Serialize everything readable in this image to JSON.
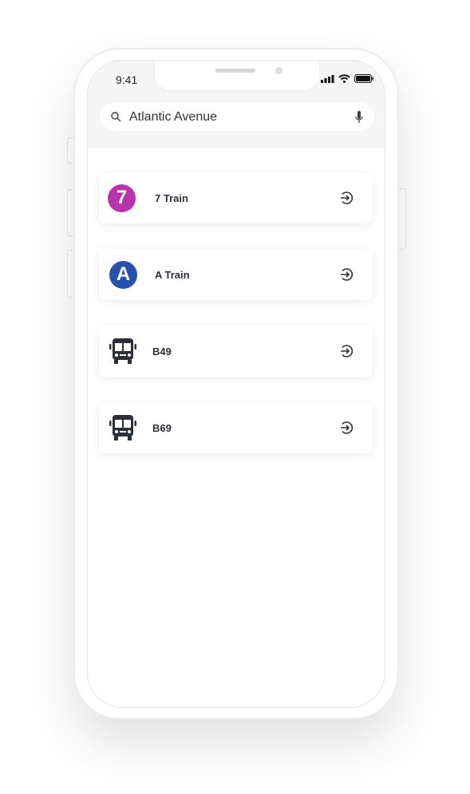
{
  "status_bar": {
    "time": "9:41"
  },
  "search": {
    "value": "Atlantic Avenue"
  },
  "routes": [
    {
      "label": "7 Train",
      "badge": "7",
      "type": "train",
      "color": "#b933ad"
    },
    {
      "label": "A Train",
      "badge": "A",
      "type": "train",
      "color": "#2850ad"
    },
    {
      "label": "B49",
      "type": "bus"
    },
    {
      "label": "B69",
      "type": "bus"
    }
  ]
}
